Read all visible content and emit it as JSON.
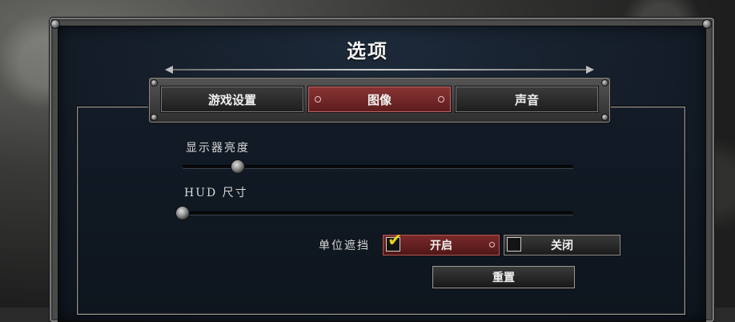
{
  "dialog": {
    "title": "选项"
  },
  "tabs": [
    {
      "label": "游戏设置",
      "active": false
    },
    {
      "label": "图像",
      "active": true
    },
    {
      "label": "声音",
      "active": false
    }
  ],
  "settings": {
    "brightness": {
      "label": "显示器亮度",
      "value_fraction": 0.13
    },
    "hud_size": {
      "label": "HUD 尺寸",
      "value_fraction": 0.0
    },
    "unit_occlusion": {
      "label": "单位遮挡",
      "on_label": "开启",
      "off_label": "关闭",
      "selected": "on"
    }
  },
  "buttons": {
    "reset_label": "重置"
  },
  "colors": {
    "active_tab": "#7a2c2c",
    "check": "#e6d21a",
    "panel_bg": "#121b26"
  },
  "icons": {
    "check": "checkmark-icon"
  }
}
